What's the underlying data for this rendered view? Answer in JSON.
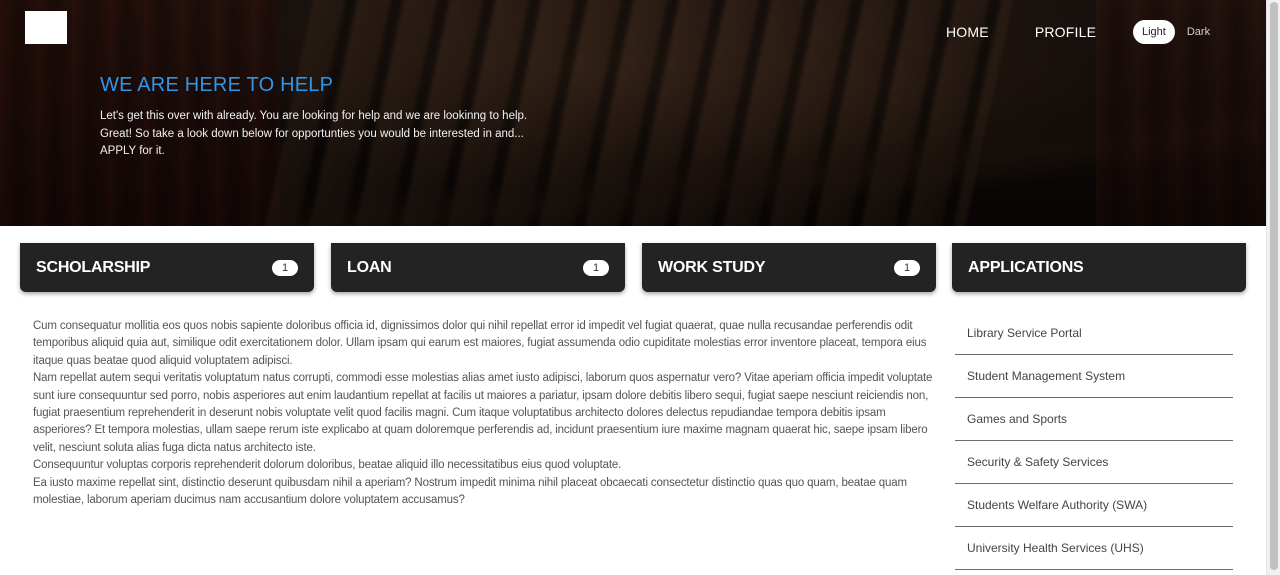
{
  "nav": {
    "home": "HOME",
    "profile": "PROFILE"
  },
  "theme": {
    "light": "Light",
    "dark": "Dark",
    "selected": "Light"
  },
  "hero": {
    "title": "WE ARE HERE TO HELP",
    "lines": [
      "Let's get this over with already. You are looking for help and we are lookinng to help.",
      "Great! So take a look down below for opportunties you would be interested in and...",
      "APPLY for it."
    ]
  },
  "cards": [
    {
      "title": "SCHOLARSHIP",
      "count": "1"
    },
    {
      "title": "LOAN",
      "count": "1"
    },
    {
      "title": "WORK STUDY",
      "count": "1"
    },
    {
      "title": "APPLICATIONS"
    }
  ],
  "body": {
    "paragraphs": [
      "Cum consequatur mollitia eos quos nobis sapiente doloribus officia id, dignissimos dolor qui nihil repellat error id impedit vel fugiat quaerat, quae nulla recusandae perferendis odit temporibus aliquid quia aut, similique odit exercitationem dolor. Ullam ipsam qui earum est maiores, fugiat assumenda odio cupiditate molestias error inventore placeat, tempora eius itaque quas beatae quod aliquid voluptatem adipisci.",
      "Nam repellat autem sequi veritatis voluptatum natus corrupti, commodi esse molestias alias amet iusto adipisci, laborum quos aspernatur vero? Vitae aperiam officia impedit voluptate sunt iure consequuntur sed porro, nobis asperiores aut enim laudantium repellat at facilis ut maiores a pariatur, ipsam dolore debitis libero sequi, fugiat saepe nesciunt reiciendis non, fugiat praesentium reprehenderit in deserunt nobis voluptate velit quod facilis magni. Cum itaque voluptatibus architecto dolores delectus repudiandae tempora debitis ipsam asperiores? Et tempora molestias, ullam saepe rerum iste explicabo at quam doloremque perferendis ad, incidunt praesentium iure maxime magnam quaerat hic, saepe ipsam libero velit, nesciunt soluta alias fuga dicta natus architecto iste.",
      "Consequuntur voluptas corporis reprehenderit dolorum doloribus, beatae aliquid illo necessitatibus eius quod voluptate.",
      "Ea iusto maxime repellat sint, distinctio deserunt quibusdam nihil a aperiam? Nostrum impedit minima nihil placeat obcaecati consectetur distinctio quas quo quam, beatae quam molestiae, laborum aperiam ducimus nam accusantium dolore voluptatem accusamus?"
    ]
  },
  "applications": [
    "Library Service Portal",
    "Student Management System",
    "Games and Sports",
    "Security & Safety Services",
    "Students Welfare Authority (SWA)",
    "University Health Services (UHS)"
  ],
  "colors": {
    "accent_title": "#2f95e8",
    "card_bg": "#232323",
    "hero_bg": "#140d0a"
  }
}
